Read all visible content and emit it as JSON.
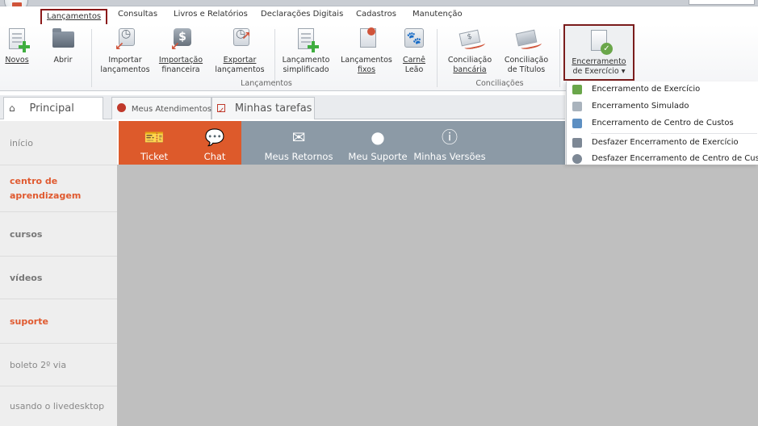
{
  "menu": {
    "tabs": [
      "Lançamentos",
      "Consultas",
      "Livros e Relatórios",
      "Declarações Digitais",
      "Cadastros",
      "Manutenção"
    ],
    "active_tab": "Lançamentos"
  },
  "ribbon": {
    "buttons": {
      "novos": "Novos",
      "abrir": "Abrir",
      "importar_1": "Importar",
      "importar_2": "lançamentos",
      "importacao_1": "Importação",
      "importacao_2": "financeira",
      "exportar_1": "Exportar",
      "exportar_2": "lançamentos",
      "simplificado_1": "Lançamento",
      "simplificado_2": "simplificado",
      "fixos_1": "Lançamentos",
      "fixos_2": "fixos",
      "carne_1": "Carnê",
      "carne_2": "Leão",
      "bancaria_1": "Conciliação",
      "bancaria_2": "bancária",
      "titulos_1": "Conciliação",
      "titulos_2": "de Títulos",
      "encerramento_1": "Encerramento",
      "encerramento_2": "de Exercício ▾"
    },
    "groups": {
      "lancamentos": "Lançamentos",
      "conciliacoes": "Conciliações"
    }
  },
  "dropdown": {
    "items": [
      "Encerramento de Exercício",
      "Encerramento Simulado",
      "Encerramento de Centro de Custos",
      "Desfazer Encerramento de Exercício",
      "Desfazer Encerramento de Centro de Custo"
    ]
  },
  "doc_tabs": {
    "principal": "Principal",
    "atendimentos": "Meus Atendimentos",
    "tarefas": "Minhas tarefas"
  },
  "toolbar": {
    "ticket": "Ticket",
    "chat": "Chat",
    "retornos": "Meus Retornos",
    "suporte": "Meu Suporte",
    "versoes": "Minhas Versões"
  },
  "sidebar": {
    "items": [
      "início",
      "centro de aprendizagem",
      "cursos",
      "vídeos",
      "suporte",
      "boleto 2º via",
      "usando o livedesktop"
    ]
  },
  "colors": {
    "accent_orange": "#dd5a2b",
    "highlight_red": "#7a1c1c",
    "tile_gray": "#8c9aa6",
    "content_gray": "#bfbfbf"
  }
}
